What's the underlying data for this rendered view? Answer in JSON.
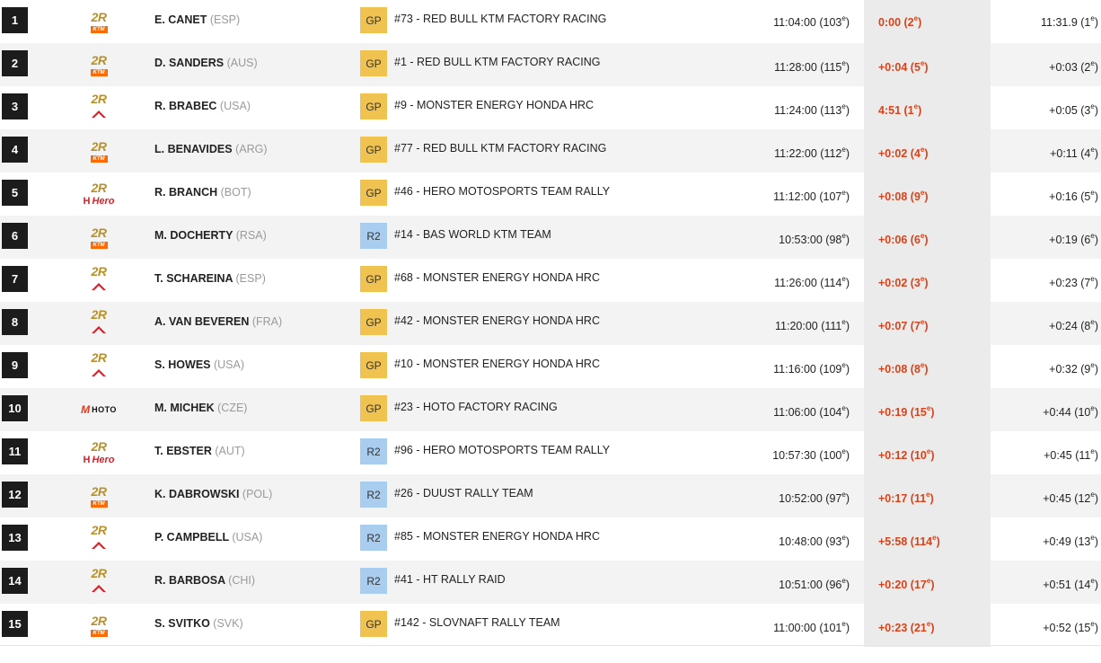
{
  "rows": [
    {
      "rank": "1",
      "brand": "ktm",
      "name": "E. CANET",
      "country": "(ESP)",
      "cat": "GP",
      "team": "#73 - RED BULL KTM FACTORY RACING",
      "time": "11:04:00 (103",
      "time_pos": "e",
      "time_end": ")",
      "gap": "0:00 (2",
      "gap_pos": "e",
      "gap_end": ")",
      "total": "11:31.9 (1",
      "total_pos": "e",
      "total_end": ")"
    },
    {
      "rank": "2",
      "brand": "ktm",
      "name": "D. SANDERS",
      "country": "(AUS)",
      "cat": "GP",
      "team": "#1 - RED BULL KTM FACTORY RACING",
      "time": "11:28:00 (115",
      "time_pos": "e",
      "time_end": ")",
      "gap": "+0:04 (5",
      "gap_pos": "e",
      "gap_end": ")",
      "total": "+0:03 (2",
      "total_pos": "e",
      "total_end": ")"
    },
    {
      "rank": "3",
      "brand": "honda",
      "name": "R. BRABEC",
      "country": "(USA)",
      "cat": "GP",
      "team": "#9 - MONSTER ENERGY HONDA HRC",
      "time": "11:24:00 (113",
      "time_pos": "e",
      "time_end": ")",
      "gap": "4:51 (1",
      "gap_pos": "e",
      "gap_end": ")",
      "total": "+0:05 (3",
      "total_pos": "e",
      "total_end": ")"
    },
    {
      "rank": "4",
      "brand": "ktm",
      "name": "L. BENAVIDES",
      "country": "(ARG)",
      "cat": "GP",
      "team": "#77 - RED BULL KTM FACTORY RACING",
      "time": "11:22:00 (112",
      "time_pos": "e",
      "time_end": ")",
      "gap": "+0:02 (4",
      "gap_pos": "e",
      "gap_end": ")",
      "total": "+0:11 (4",
      "total_pos": "e",
      "total_end": ")"
    },
    {
      "rank": "5",
      "brand": "hero",
      "name": "R. BRANCH",
      "country": "(BOT)",
      "cat": "GP",
      "team": "#46 - HERO MOTOSPORTS TEAM RALLY",
      "time": "11:12:00 (107",
      "time_pos": "e",
      "time_end": ")",
      "gap": "+0:08 (9",
      "gap_pos": "e",
      "gap_end": ")",
      "total": "+0:16 (5",
      "total_pos": "e",
      "total_end": ")"
    },
    {
      "rank": "6",
      "brand": "ktm",
      "name": "M. DOCHERTY",
      "country": "(RSA)",
      "cat": "R2",
      "team": "#14 - BAS WORLD KTM TEAM",
      "time": "10:53:00 (98",
      "time_pos": "e",
      "time_end": ")",
      "gap": "+0:06 (6",
      "gap_pos": "e",
      "gap_end": ")",
      "total": "+0:19 (6",
      "total_pos": "e",
      "total_end": ")"
    },
    {
      "rank": "7",
      "brand": "honda",
      "name": "T. SCHAREINA",
      "country": "(ESP)",
      "cat": "GP",
      "team": "#68 - MONSTER ENERGY HONDA HRC",
      "time": "11:26:00 (114",
      "time_pos": "e",
      "time_end": ")",
      "gap": "+0:02 (3",
      "gap_pos": "e",
      "gap_end": ")",
      "total": "+0:23 (7",
      "total_pos": "e",
      "total_end": ")"
    },
    {
      "rank": "8",
      "brand": "honda",
      "name": "A. VAN BEVEREN",
      "country": "(FRA)",
      "cat": "GP",
      "team": "#42 - MONSTER ENERGY HONDA HRC",
      "time": "11:20:00 (111",
      "time_pos": "e",
      "time_end": ")",
      "gap": "+0:07 (7",
      "gap_pos": "e",
      "gap_end": ")",
      "total": "+0:24 (8",
      "total_pos": "e",
      "total_end": ")"
    },
    {
      "rank": "9",
      "brand": "honda",
      "name": "S. HOWES",
      "country": "(USA)",
      "cat": "GP",
      "team": "#10 - MONSTER ENERGY HONDA HRC",
      "time": "11:16:00 (109",
      "time_pos": "e",
      "time_end": ")",
      "gap": "+0:08 (8",
      "gap_pos": "e",
      "gap_end": ")",
      "total": "+0:32 (9",
      "total_pos": "e",
      "total_end": ")"
    },
    {
      "rank": "10",
      "brand": "hoto",
      "name": "M. MICHEK",
      "country": "(CZE)",
      "cat": "GP",
      "team": "#23 - HOTO FACTORY RACING",
      "time": "11:06:00 (104",
      "time_pos": "e",
      "time_end": ")",
      "gap": "+0:19 (15",
      "gap_pos": "e",
      "gap_end": ")",
      "total": "+0:44 (10",
      "total_pos": "e",
      "total_end": ")"
    },
    {
      "rank": "11",
      "brand": "hero",
      "name": "T. EBSTER",
      "country": "(AUT)",
      "cat": "R2",
      "team": "#96 - HERO MOTOSPORTS TEAM RALLY",
      "time": "10:57:30 (100",
      "time_pos": "e",
      "time_end": ")",
      "gap": "+0:12 (10",
      "gap_pos": "e",
      "gap_end": ")",
      "total": "+0:45 (11",
      "total_pos": "e",
      "total_end": ")"
    },
    {
      "rank": "12",
      "brand": "ktm",
      "name": "K. DABROWSKI",
      "country": "(POL)",
      "cat": "R2",
      "team": "#26 - DUUST RALLY TEAM",
      "time": "10:52:00 (97",
      "time_pos": "e",
      "time_end": ")",
      "gap": "+0:17 (11",
      "gap_pos": "e",
      "gap_end": ")",
      "total": "+0:45 (12",
      "total_pos": "e",
      "total_end": ")"
    },
    {
      "rank": "13",
      "brand": "honda",
      "name": "P. CAMPBELL",
      "country": "(USA)",
      "cat": "R2",
      "team": "#85 - MONSTER ENERGY HONDA HRC",
      "time": "10:48:00 (93",
      "time_pos": "e",
      "time_end": ")",
      "gap": "+5:58 (114",
      "gap_pos": "e",
      "gap_end": ")",
      "total": "+0:49 (13",
      "total_pos": "e",
      "total_end": ")"
    },
    {
      "rank": "14",
      "brand": "honda",
      "name": "R. BARBOSA",
      "country": "(CHI)",
      "cat": "R2",
      "team": "#41 - HT RALLY RAID",
      "time": "10:51:00 (96",
      "time_pos": "e",
      "time_end": ")",
      "gap": "+0:20 (17",
      "gap_pos": "e",
      "gap_end": ")",
      "total": "+0:51 (14",
      "total_pos": "e",
      "total_end": ")"
    },
    {
      "rank": "15",
      "brand": "ktm",
      "name": "S. SVITKO",
      "country": "(SVK)",
      "cat": "GP",
      "team": "#142 - SLOVNAFT RALLY TEAM",
      "time": "11:00:00 (101",
      "time_pos": "e",
      "time_end": ")",
      "gap": "+0:23 (21",
      "gap_pos": "e",
      "gap_end": ")",
      "total": "+0:52 (15",
      "total_pos": "e",
      "total_end": ")"
    }
  ],
  "brands": {
    "ktm": {
      "tag": "2R",
      "word": "KTM"
    },
    "honda": {
      "tag": "2R",
      "word": "HONDA"
    },
    "hero": {
      "tag": "2R",
      "word": "Hero"
    },
    "hoto": {
      "tag": "",
      "word": "HOTO"
    }
  },
  "colors": {
    "gp": "#f0c24f",
    "r2": "#a9cdef",
    "gap_text": "#d4441c",
    "rank_bg": "#1c1c1c",
    "tag_gold": "#b8912a"
  }
}
